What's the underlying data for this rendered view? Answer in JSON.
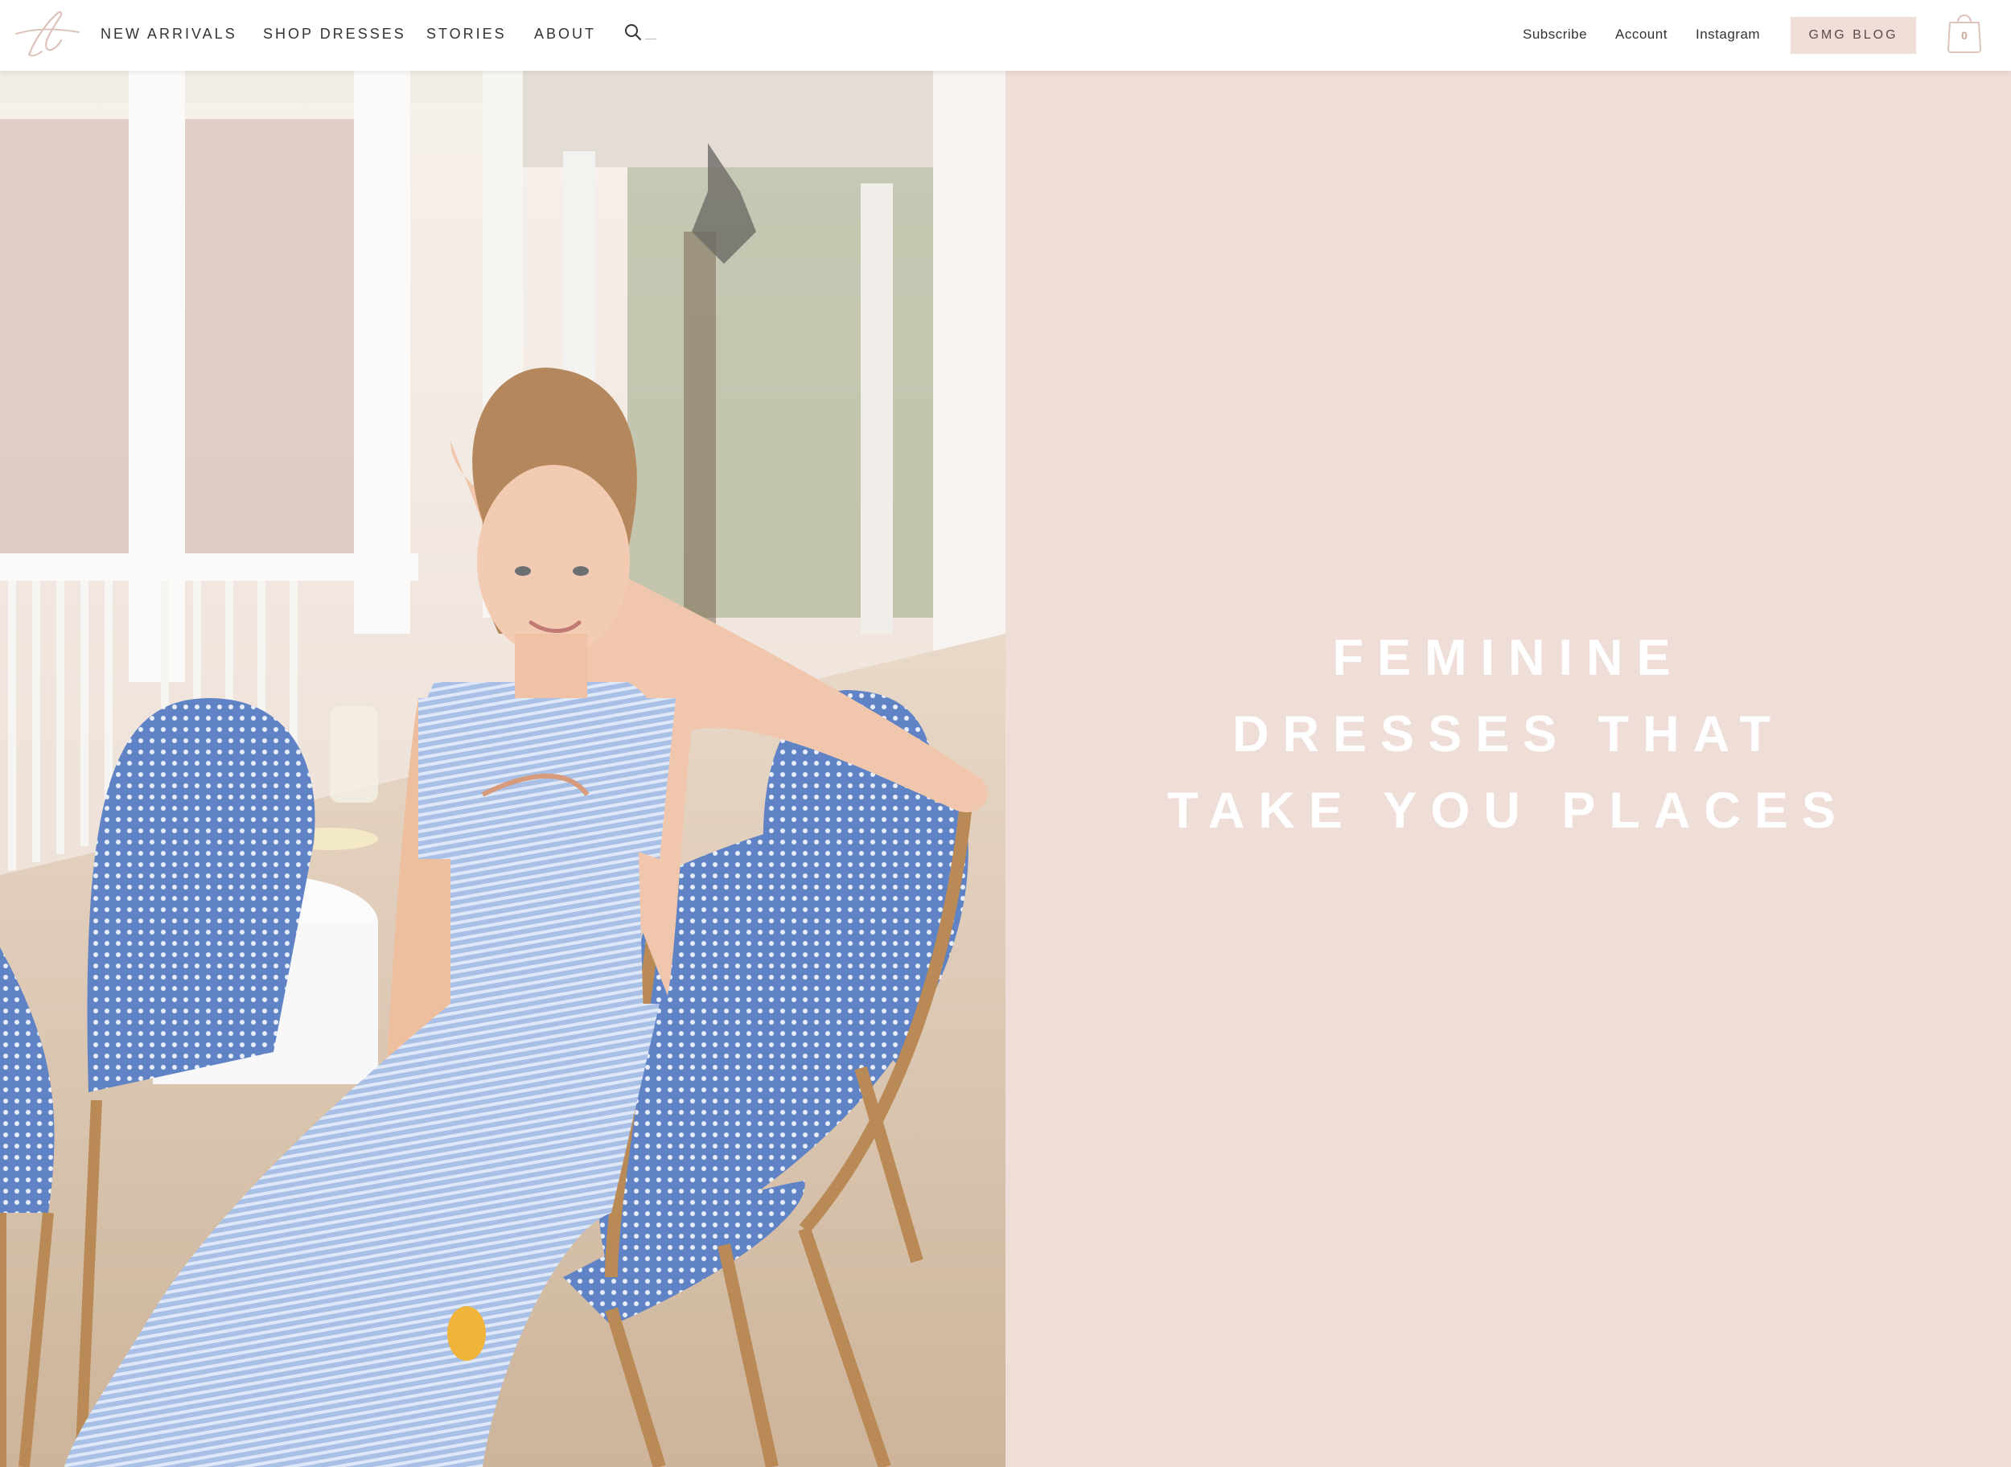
{
  "header": {
    "logo": "gmg-logo",
    "nav": [
      {
        "label": "NEW ARRIVALS"
      },
      {
        "label": "SHOP DRESSES"
      },
      {
        "label": "STORIES"
      },
      {
        "label": "ABOUT"
      }
    ],
    "search": {
      "icon": "search-icon",
      "placeholder": ""
    },
    "utility": [
      {
        "label": "Subscribe"
      },
      {
        "label": "Account"
      },
      {
        "label": "Instagram"
      }
    ],
    "blog_button": "GMG BLOG",
    "cart": {
      "icon": "shopping-bag-icon",
      "count": "0"
    }
  },
  "hero": {
    "photo": "woman-in-striped-dress-on-porch",
    "headline_lines": [
      "FEMININE",
      "DRESSES THAT",
      "TAKE YOU PLACES"
    ]
  },
  "colors": {
    "accent": "#efded8",
    "header_bg": "#ffffff",
    "headline": "#ffffff",
    "dress": "#9bb5e0"
  }
}
